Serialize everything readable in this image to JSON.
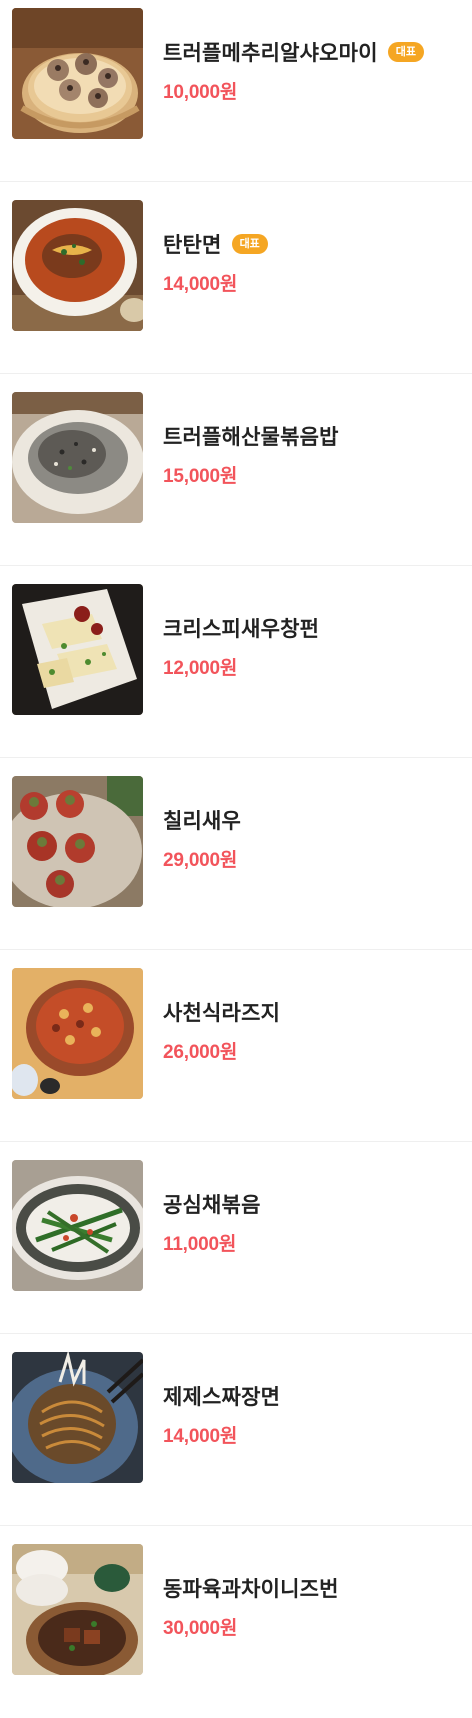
{
  "menu": {
    "items": [
      {
        "name": "트러플메추리알샤오마이",
        "price": "10,000원",
        "badge": "대표",
        "photo": "shumai-basket"
      },
      {
        "name": "탄탄면",
        "price": "14,000원",
        "badge": "대표",
        "photo": "dandan-noodles-bowl"
      },
      {
        "name": "트러플해산물볶음밥",
        "price": "15,000원",
        "badge": "",
        "photo": "fried-rice-plate"
      },
      {
        "name": "크리스피새우창펀",
        "price": "12,000원",
        "badge": "",
        "photo": "shrimp-rice-rolls-plate"
      },
      {
        "name": "칠리새우",
        "price": "29,000원",
        "badge": "",
        "photo": "chili-shrimp-plate"
      },
      {
        "name": "사천식라즈지",
        "price": "26,000원",
        "badge": "",
        "photo": "laziji-bowl"
      },
      {
        "name": "공심채볶음",
        "price": "11,000원",
        "badge": "",
        "photo": "water-spinach-plate"
      },
      {
        "name": "제제스짜장면",
        "price": "14,000원",
        "badge": "",
        "photo": "jjajang-noodles-plate"
      },
      {
        "name": "동파육과차이니즈번",
        "price": "30,000원",
        "badge": "",
        "photo": "dongpo-pork-buns"
      }
    ]
  }
}
